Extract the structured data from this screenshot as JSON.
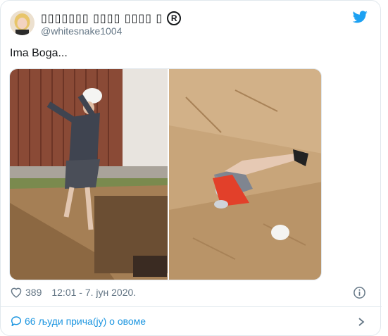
{
  "tweet": {
    "author": {
      "display_name": "▯▯▯▯▯▯▯ ▯▯▯▯ ▯▯▯▯ ▯",
      "registered_mark": "R",
      "handle": "@whitesnake1004"
    },
    "text": "Ima Boga...",
    "likes": "389",
    "timestamp": "12:01 - 7. јун 2020.",
    "conversation_label": "66 људи прича(ју) о овоме"
  },
  "icons": {
    "logo": "twitter-bird-icon",
    "like": "heart-icon",
    "info": "info-icon",
    "conversation": "speech-bubble-icon",
    "chevron": "chevron-right-icon"
  },
  "colors": {
    "accent": "#1da1f2",
    "link": "#1b95e0",
    "secondary_text": "#657786",
    "border": "#e1e8ed"
  }
}
